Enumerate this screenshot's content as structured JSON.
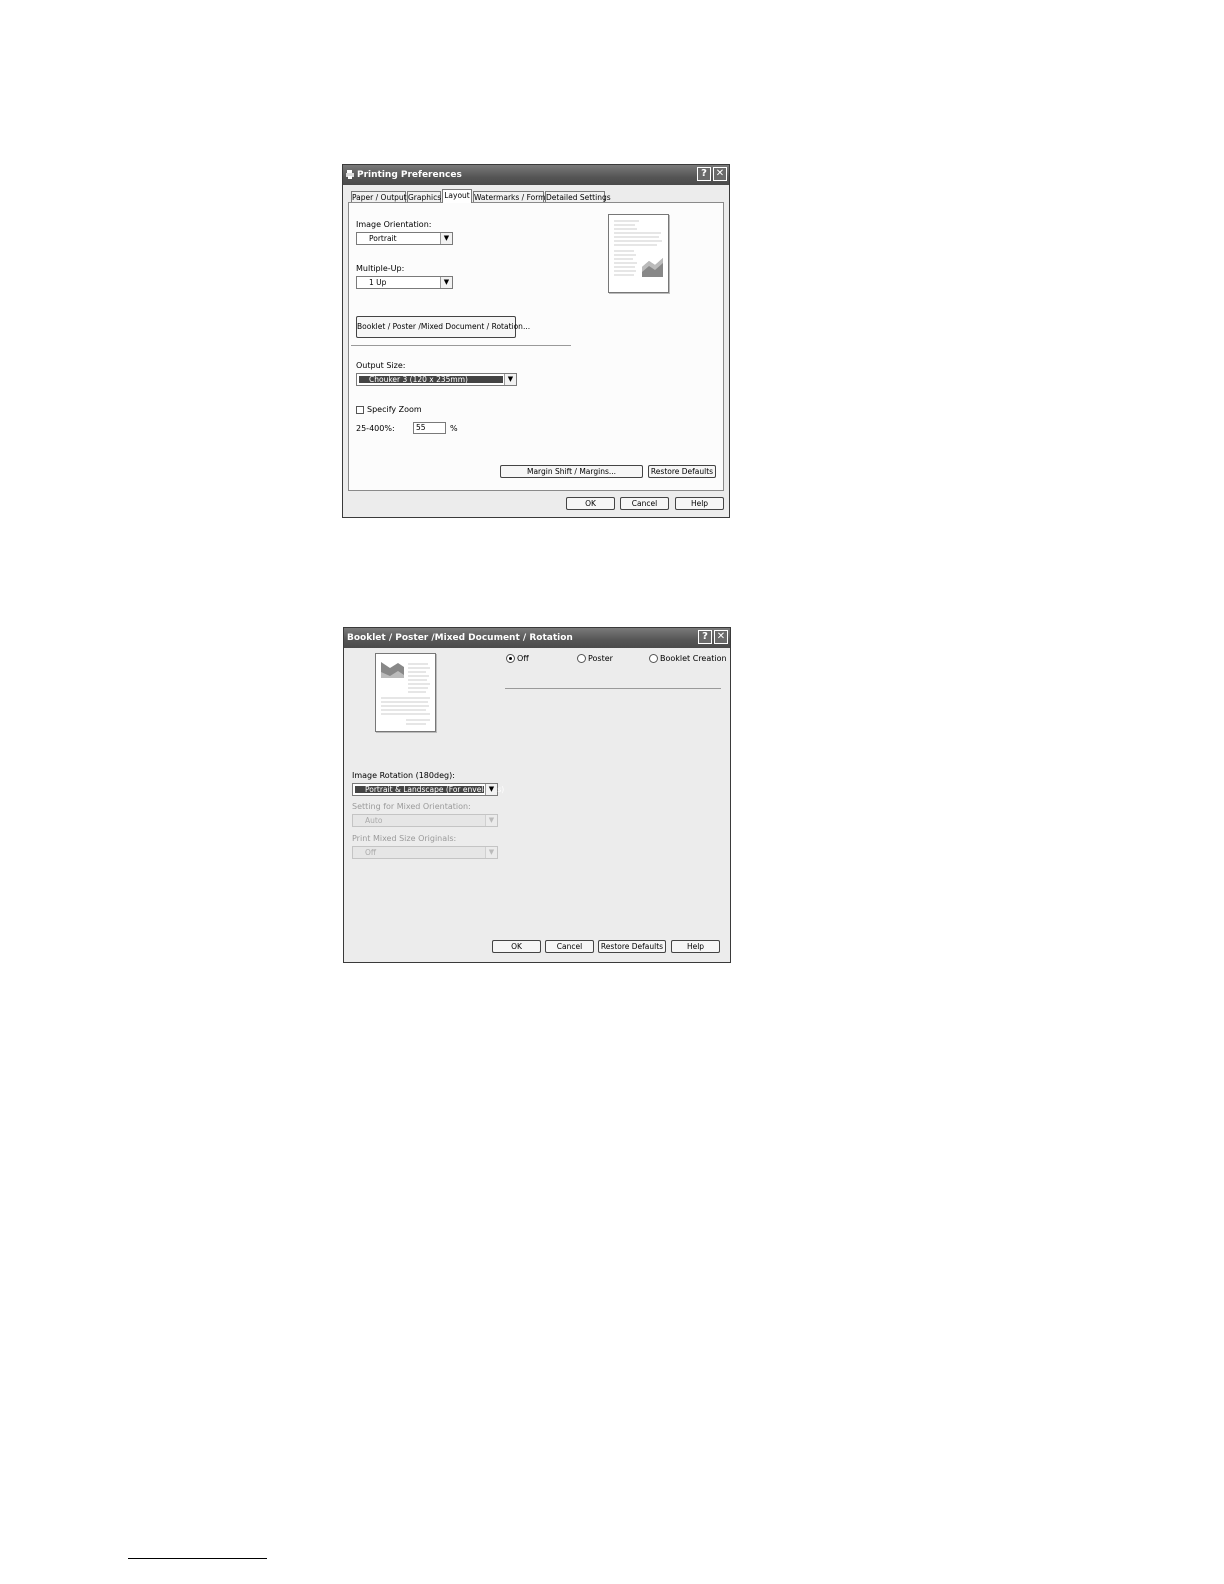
{
  "dialog1": {
    "title": "Printing Preferences",
    "tabs": [
      {
        "label": "Paper / Output"
      },
      {
        "label": "Graphics"
      },
      {
        "label": "Layout"
      },
      {
        "label": "Watermarks / Forms"
      },
      {
        "label": "Detailed Settings"
      }
    ],
    "active_tab": "Layout",
    "image_orientation": {
      "label": "Image Orientation:",
      "value": "Portrait"
    },
    "multiple_up": {
      "label": "Multiple-Up:",
      "value": "1 Up"
    },
    "booklet_button": "Booklet / Poster /Mixed Document / Rotation...",
    "output_size": {
      "label": "Output Size:",
      "value": "Chouker 3 (120 x 235mm)"
    },
    "specify_zoom": {
      "label": "Specify Zoom",
      "checked": false
    },
    "zoom": {
      "label": "25-400%:",
      "value": "55",
      "unit": "%"
    },
    "margin_button": "Margin Shift / Margins...",
    "restore_button": "Restore Defaults",
    "ok": "OK",
    "cancel": "Cancel",
    "help": "Help"
  },
  "dialog2": {
    "title": "Booklet / Poster /Mixed Document / Rotation",
    "options": [
      {
        "label": "Off",
        "selected": true
      },
      {
        "label": "Poster",
        "selected": false
      },
      {
        "label": "Booklet Creation",
        "selected": false
      }
    ],
    "image_rotation": {
      "label": "Image Rotation (180deg):",
      "value": "Portrait & Landscape (For envelopes)"
    },
    "mixed_orientation": {
      "label": "Setting for Mixed Orientation:",
      "value": "Auto",
      "disabled": true
    },
    "mixed_size": {
      "label": "Print Mixed Size Originals:",
      "value": "Off",
      "disabled": true
    },
    "ok": "OK",
    "cancel": "Cancel",
    "restore": "Restore Defaults",
    "help": "Help"
  },
  "icons": {
    "help": "?",
    "close": "✕",
    "dropdown": "▼"
  }
}
